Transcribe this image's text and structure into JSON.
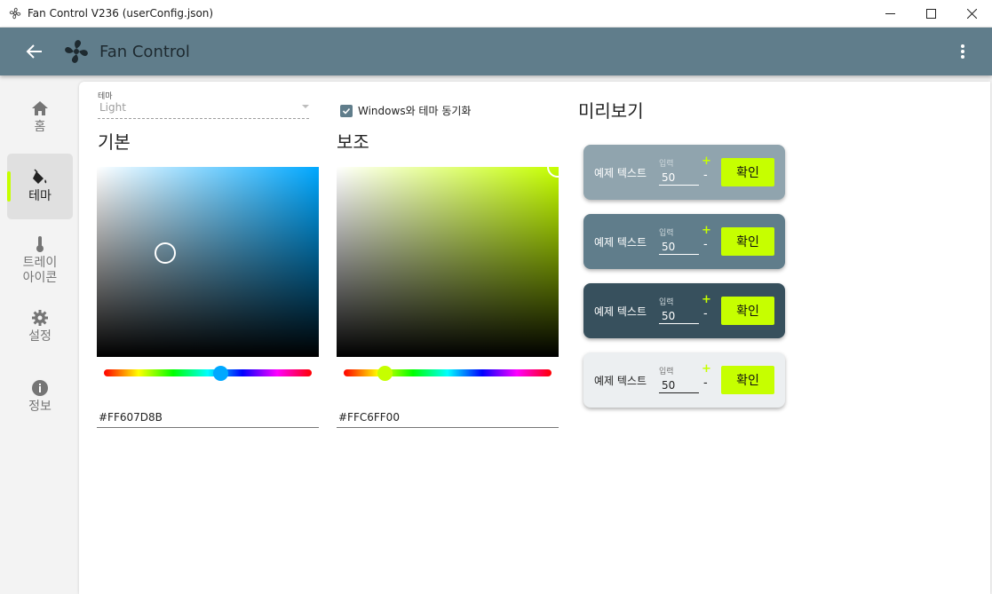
{
  "window": {
    "title": "Fan Control V236 (userConfig.json)"
  },
  "appbar": {
    "title": "Fan Control"
  },
  "sidebar": {
    "items": [
      {
        "label": "홈",
        "icon": "home-icon"
      },
      {
        "label": "테마",
        "icon": "paint-bucket-icon",
        "active": true
      },
      {
        "label": "트레이\n아이콘",
        "icon": "thermometer-icon"
      },
      {
        "label": "설정",
        "icon": "gear-icon"
      },
      {
        "label": "정보",
        "icon": "info-icon"
      }
    ]
  },
  "theme": {
    "label": "테마",
    "selected": "Light",
    "sync_label": "Windows와 테마 동기화",
    "sync_checked": true
  },
  "primary": {
    "title": "기본",
    "hex": "#FF607D8B",
    "hue_color": "#00a8ff",
    "hue_fraction": 0.56
  },
  "secondary": {
    "title": "보조",
    "hex": "#FFC6FF00",
    "hue_color": "#c6ff00",
    "hue_fraction": 0.2
  },
  "preview": {
    "title": "미리보기",
    "cards": [
      {
        "text": "예제 텍스트",
        "input_label": "입력",
        "value": "50",
        "plus": "+",
        "minus": "-",
        "button": "확인",
        "bg": "#90a4ae"
      },
      {
        "text": "예제 텍스트",
        "input_label": "입력",
        "value": "50",
        "plus": "+",
        "minus": "-",
        "button": "확인",
        "bg": "#607d8b"
      },
      {
        "text": "예제 텍스트",
        "input_label": "입력",
        "value": "50",
        "plus": "+",
        "minus": "-",
        "button": "확인",
        "bg": "#37505d"
      },
      {
        "text": "예제 텍스트",
        "input_label": "입력",
        "value": "50",
        "plus": "+",
        "minus": "-",
        "button": "확인",
        "bg": "#eceff1"
      }
    ]
  },
  "colors": {
    "accent": "#c6ff00",
    "appbar": "#607d8b"
  }
}
